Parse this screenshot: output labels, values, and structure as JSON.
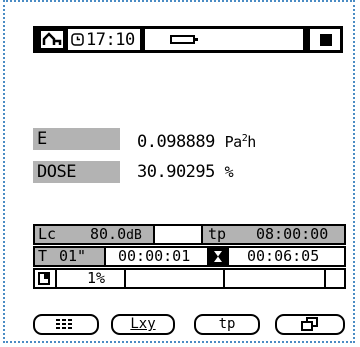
{
  "status": {
    "mode_icon": "level-meter-icon",
    "time": "17:10",
    "clock_icon": "clock-icon",
    "battery_icon": "battery-icon",
    "stop_icon": "stop-square-icon"
  },
  "readings": [
    {
      "label": "E",
      "value": "0.098889",
      "unit_main": "Pa",
      "unit_sup": "2",
      "unit_tail": "h"
    },
    {
      "label": "DOSE",
      "value": "30.90295",
      "unit_main": "%",
      "unit_sup": "",
      "unit_tail": ""
    }
  ],
  "panel": {
    "lc_label": "Lc",
    "lc_value": "80.0",
    "lc_unit": "dB",
    "tp_label": "tp",
    "tp_value": "08:00:00",
    "t_label": "T",
    "t_value": "01\"",
    "elapsed": "00:00:01",
    "timer_icon": "hourglass-icon",
    "remaining": "00:06:05",
    "mem_icon": "memory-icon",
    "mem_value": "1%"
  },
  "softkeys": [
    {
      "label": "",
      "icon": "keypad-icon"
    },
    {
      "label": "Lxy",
      "icon": ""
    },
    {
      "label": "tp",
      "icon": ""
    },
    {
      "label": "",
      "icon": "windows-icon"
    }
  ]
}
